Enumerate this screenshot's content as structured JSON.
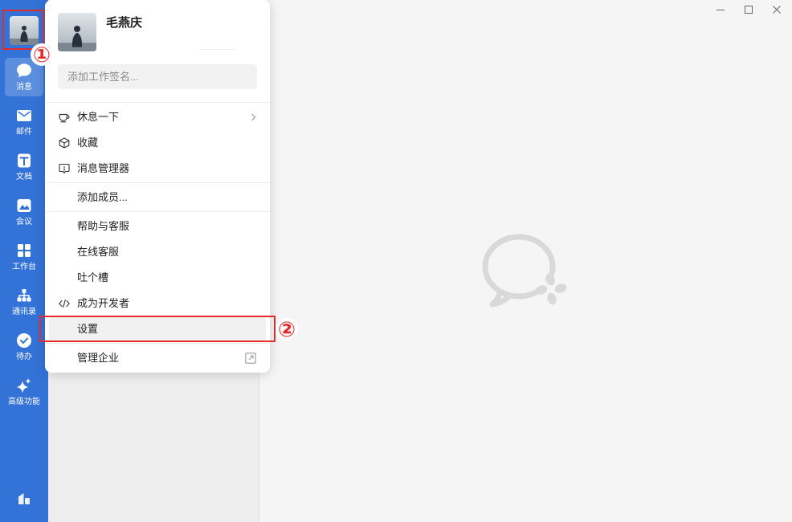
{
  "colors": {
    "sidebar_bg": "#3372d6",
    "annotation_red": "#e32b2b",
    "list_panel_bg": "#ededed",
    "main_bg": "#f5f5f5",
    "menu_highlight_bg": "#f1f1f1"
  },
  "window": {
    "controls": [
      "minimize-icon",
      "maximize-icon",
      "close-icon"
    ]
  },
  "sidebar": {
    "avatar": "user-avatar-image",
    "items": [
      {
        "label": "消息",
        "icon": "message-icon",
        "selected": true
      },
      {
        "label": "邮件",
        "icon": "mail-icon",
        "selected": false
      },
      {
        "label": "文档",
        "icon": "document-icon",
        "selected": false
      },
      {
        "label": "会议",
        "icon": "meeting-icon",
        "selected": false
      },
      {
        "label": "工作台",
        "icon": "workbench-icon",
        "selected": false
      },
      {
        "label": "通讯录",
        "icon": "contacts-icon",
        "selected": false
      },
      {
        "label": "待办",
        "icon": "todo-icon",
        "selected": false
      },
      {
        "label": "高级功能",
        "icon": "advanced-features-icon",
        "selected": false
      }
    ],
    "bottom_icon": "enterprise-icon"
  },
  "main": {
    "placeholder_logo": "wecom-logo-icon"
  },
  "profile_menu": {
    "name": "毛燕庆",
    "signature_placeholder": "添加工作签名...",
    "groups": [
      [
        {
          "label": "休息一下",
          "icon": "coffee-cup-icon",
          "trailing_icon": "chevron-right-icon"
        },
        {
          "label": "收藏",
          "icon": "cube-icon"
        },
        {
          "label": "消息管理器",
          "icon": "message-manager-icon"
        }
      ],
      [
        {
          "label": "添加成员..."
        }
      ],
      [
        {
          "label": "帮助与客服"
        },
        {
          "label": "在线客服"
        },
        {
          "label": "吐个槽"
        },
        {
          "label": "成为开发者",
          "icon": "code-icon"
        },
        {
          "label": "设置",
          "highlighted": true
        }
      ],
      [
        {
          "label": "管理企业",
          "trailing_icon": "external-link-icon"
        }
      ]
    ]
  },
  "annotations": [
    {
      "label": "①"
    },
    {
      "label": "②"
    }
  ]
}
